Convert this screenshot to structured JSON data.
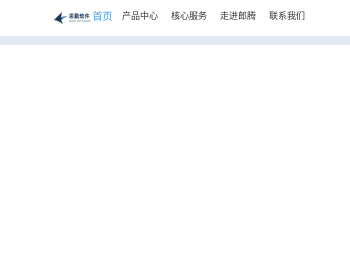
{
  "header": {
    "logo": {
      "name_cn": "思勤软件",
      "name_en": "SIQIN SOFTWARE"
    },
    "home_label": "首页",
    "nav": [
      {
        "label": "产品中心"
      },
      {
        "label": "核心服务"
      },
      {
        "label": "走进郎腾"
      },
      {
        "label": "联系我们"
      }
    ]
  },
  "colors": {
    "accent": "#4a9fe0",
    "band": "#e3e8f2",
    "logo_dark": "#1d3557",
    "text": "#333333"
  }
}
